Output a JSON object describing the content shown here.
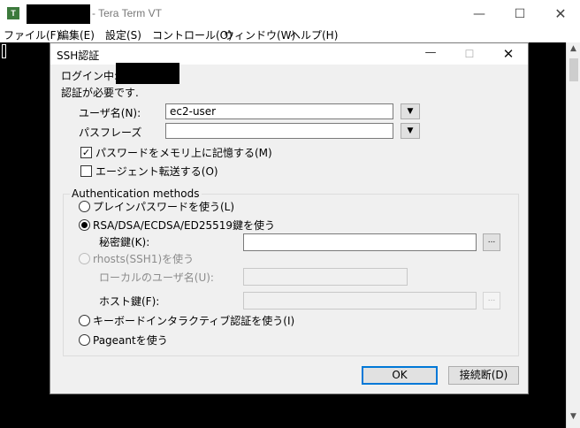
{
  "window": {
    "app_icon_text": "T",
    "title": "- Tera Term VT",
    "minimize": "—",
    "maximize": "☐",
    "close": "✕"
  },
  "menu": {
    "items": [
      {
        "label": "ファイル(F)"
      },
      {
        "label": "編集(E)"
      },
      {
        "label": "設定(S)"
      },
      {
        "label": "コントロール(O)"
      },
      {
        "label": "ウィンドウ(W)"
      },
      {
        "label": "ヘルプ(H)"
      }
    ]
  },
  "dialog": {
    "title": "SSH認証",
    "minimize": "—",
    "maximize": "☐",
    "close": "✕",
    "login_prefix": "ログイン中:",
    "auth_required": "認証が必要です.",
    "username_label": "ユーザ名(N):",
    "username_value": "ec2-user",
    "passphrase_label": "パスフレーズ",
    "passphrase_value": "",
    "remember_password_label": "パスワードをメモリ上に記憶する(M)",
    "remember_password_checked": true,
    "agent_forward_label": "エージェント転送する(O)",
    "agent_forward_checked": false,
    "methods_group_label": "Authentication methods",
    "plain_password_label": "プレインパスワードを使う(L)",
    "rsa_label": "RSA/DSA/ECDSA/ED25519鍵を使う",
    "private_key_label": "秘密鍵(K):",
    "private_key_value": "",
    "rhosts_label": "rhosts(SSH1)を使う",
    "local_user_label": "ローカルのユーザ名(U):",
    "host_key_label": "ホスト鍵(F):",
    "keyboard_interactive_label": "キーボードインタラクティブ認証を使う(I)",
    "pageant_label": "Pageantを使う",
    "selected_method": "rsa",
    "browse_label": "...",
    "dropdown_arrow": "▼",
    "ok_label": "OK",
    "disconnect_label": "接続断(D)"
  },
  "scrollbar": {
    "up_arrow": "▲",
    "down_arrow": "▼"
  }
}
